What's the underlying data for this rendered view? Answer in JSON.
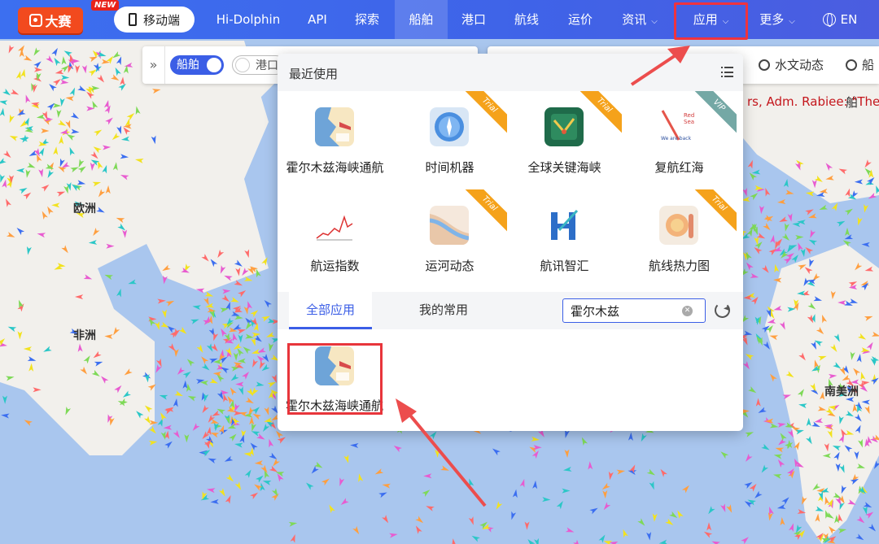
{
  "nav": {
    "logo_text": "大赛",
    "new_badge": "NEW",
    "mobile_label": "移动端",
    "items": [
      {
        "label": "Hi-Dolphin"
      },
      {
        "label": "API"
      },
      {
        "label": "探索"
      },
      {
        "label": "船舶"
      },
      {
        "label": "港口"
      },
      {
        "label": "航线"
      },
      {
        "label": "运价"
      },
      {
        "label": "资讯"
      },
      {
        "label": "应用"
      },
      {
        "label": "更多"
      },
      {
        "label": "EN"
      }
    ],
    "active_item": "船舶",
    "highlighted_item": "应用",
    "accent_color": "#3c6ff0"
  },
  "toolbar": {
    "ship_toggle": "船舶",
    "port_toggle": "港口",
    "hydro_label": "水文动态",
    "ship_label": "船舶"
  },
  "ticker": "rs, Adm. Rabiee: \"The S",
  "map": {
    "labels": {
      "europe": "欧洲",
      "africa": "非洲",
      "south_america": "南美洲"
    }
  },
  "panel": {
    "recent_title": "最近使用",
    "recent_apps": [
      {
        "name": "霍尔木兹海峡通航",
        "badge": ""
      },
      {
        "name": "时间机器",
        "badge": "Trial"
      },
      {
        "name": "全球关键海峡",
        "badge": "Trial"
      },
      {
        "name": "复航红海",
        "badge": "VIP"
      },
      {
        "name": "航运指数",
        "badge": ""
      },
      {
        "name": "运河动态",
        "badge": "Trial"
      },
      {
        "name": "航讯智汇",
        "badge": ""
      },
      {
        "name": "航线热力图",
        "badge": "Trial"
      }
    ],
    "thumb_text": {
      "redsea_line1": "Red",
      "redsea_line2": "Sea",
      "redsea_line3": "We are back"
    },
    "tabs": {
      "all": "全部应用",
      "fav": "我的常用"
    },
    "search_value": "霍尔木兹",
    "results": [
      {
        "name": "霍尔木兹海峡通航"
      }
    ]
  }
}
